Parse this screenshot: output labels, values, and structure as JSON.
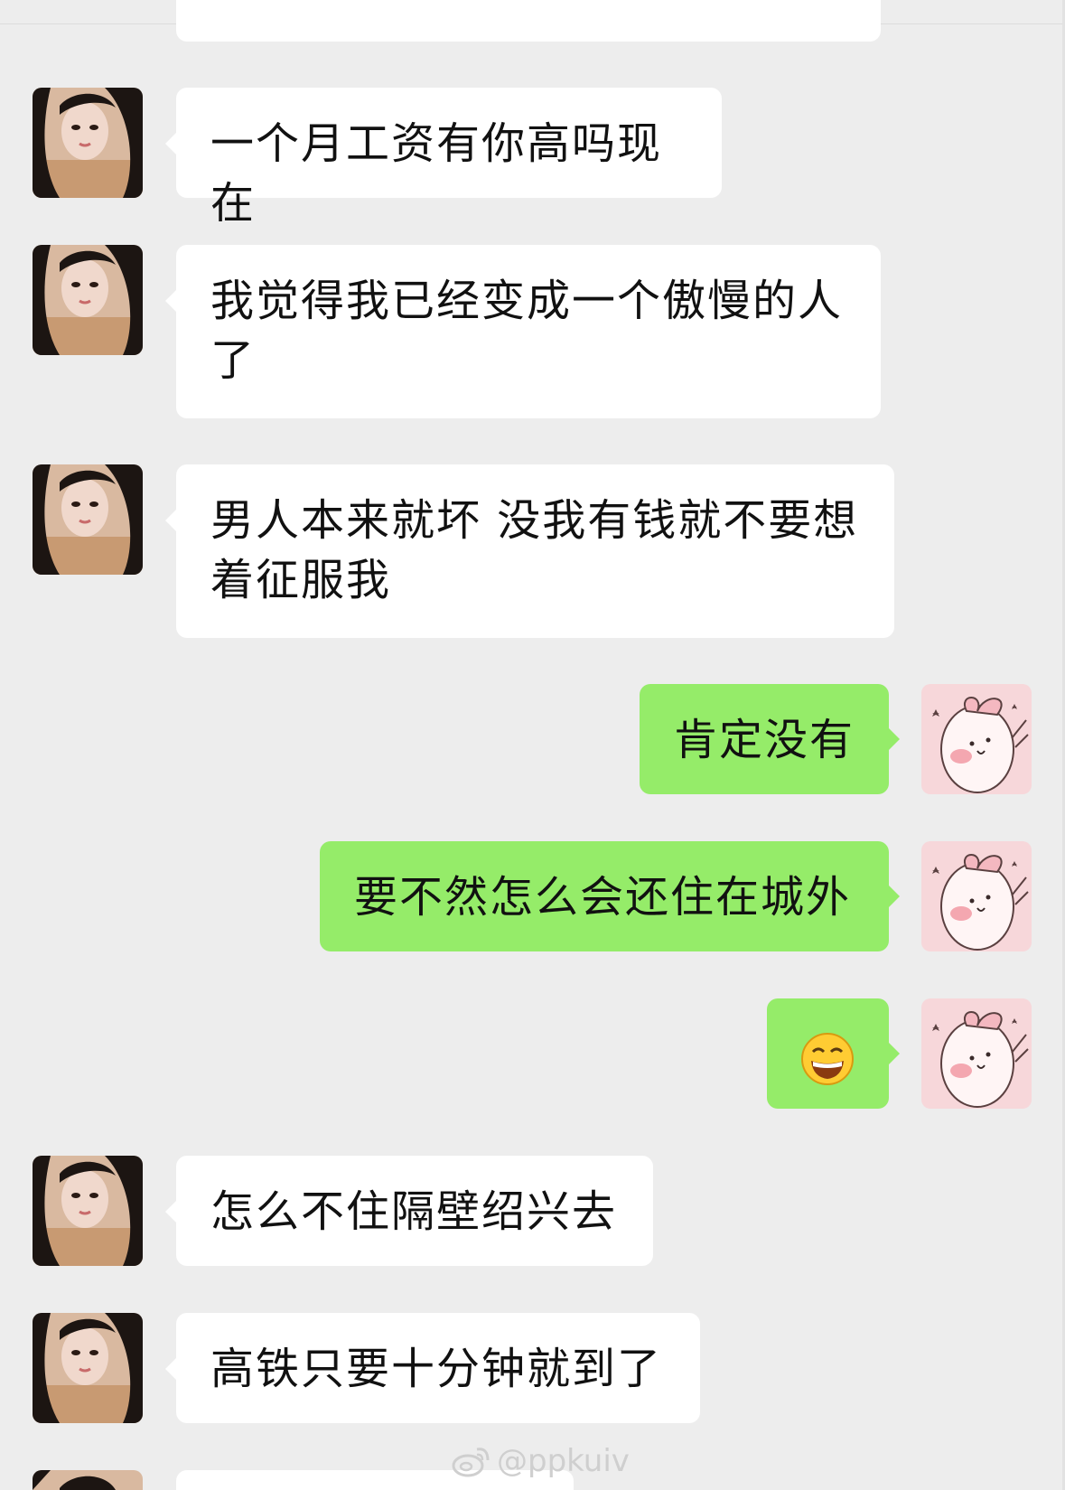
{
  "messages": [
    {
      "side": "in",
      "text": "一个月工资有你高吗现在"
    },
    {
      "side": "in",
      "text": "我觉得我已经变成一个傲慢的人了"
    },
    {
      "side": "in",
      "text": "男人本来就坏 没我有钱就不要想着征服我"
    },
    {
      "side": "out",
      "text": "肯定没有"
    },
    {
      "side": "out",
      "text": "要不然怎么会还住在城外"
    },
    {
      "side": "out",
      "emoji": "grin-emoji"
    },
    {
      "side": "in",
      "text": "怎么不住隔壁绍兴去"
    },
    {
      "side": "in",
      "text": "高铁只要十分钟就到了"
    }
  ],
  "watermark": "@ppkuiv",
  "colors": {
    "background": "#ededed",
    "incoming": "#ffffff",
    "outgoing": "#95ec69"
  }
}
